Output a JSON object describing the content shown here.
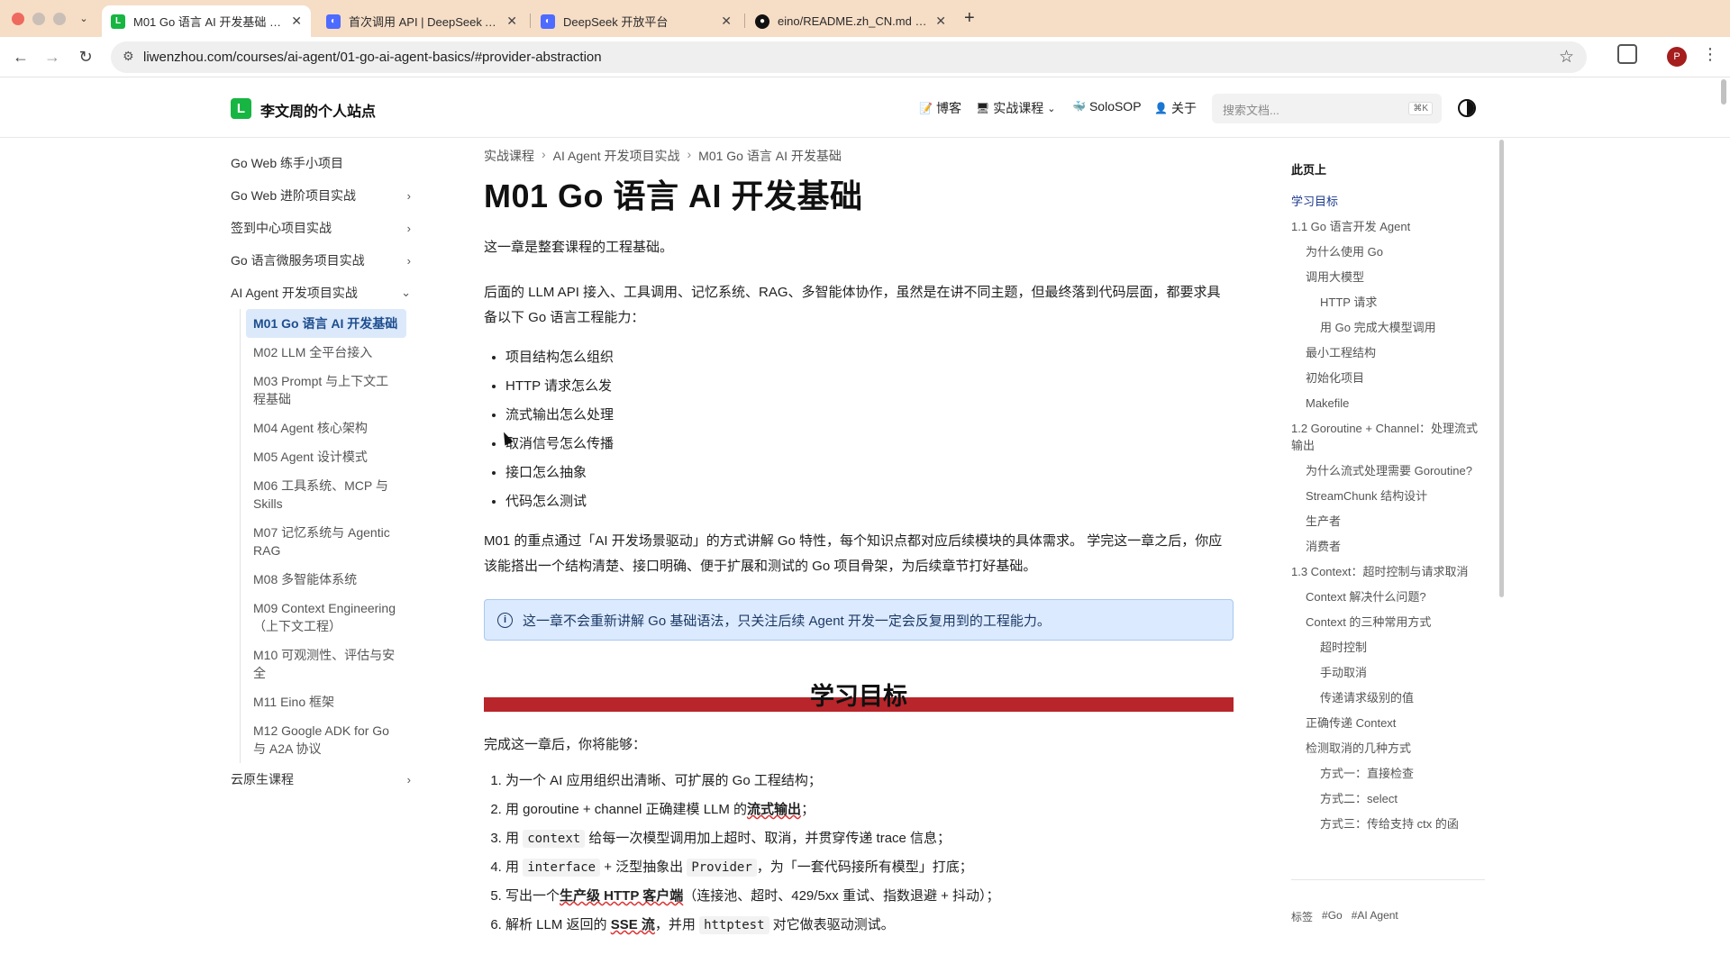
{
  "browser": {
    "tabs": [
      {
        "title": "M01 Go 语言 AI 开发基础 – 李文...",
        "icon": "L",
        "active": true
      },
      {
        "title": "首次调用 API | DeepSeek API D...",
        "icon": "deepseek-icon",
        "active": false
      },
      {
        "title": "DeepSeek 开放平台",
        "icon": "deepseek-icon",
        "active": false
      },
      {
        "title": "eino/README.zh_CN.md at m...",
        "icon": "github-icon",
        "active": false
      }
    ],
    "url": "liwenzhou.com/courses/ai-agent/01-go-ai-agent-basics/#provider-abstraction",
    "profile_initial": "P"
  },
  "site": {
    "logo_letter": "L",
    "title": "李文周的个人站点",
    "nav": {
      "blog": "博客",
      "courses": "实战课程",
      "solosop": "SoloSOP",
      "about": "关于"
    },
    "search_placeholder": "搜索文档...",
    "search_shortcut": "⌘K"
  },
  "sidebar": {
    "items": [
      {
        "label": "Go Web 练手小项目",
        "chevron": ""
      },
      {
        "label": "Go Web 进阶项目实战",
        "chevron": "›"
      },
      {
        "label": "签到中心项目实战",
        "chevron": "›"
      },
      {
        "label": "Go 语言微服务项目实战",
        "chevron": "›"
      },
      {
        "label": "AI Agent 开发项目实战",
        "chevron": "⌄"
      }
    ],
    "children": [
      "M01 Go 语言 AI 开发基础",
      "M02 LLM 全平台接入",
      "M03 Prompt 与上下文工程基础",
      "M04 Agent 核心架构",
      "M05 Agent 设计模式",
      "M06 工具系统、MCP 与 Skills",
      "M07 记忆系统与 Agentic RAG",
      "M08 多智能体系统",
      "M09 Context Engineering（上下文工程）",
      "M10 可观测性、评估与安全",
      "M11 Eino 框架",
      "M12 Google ADK for Go 与 A2A 协议"
    ],
    "last": {
      "label": "云原生课程",
      "chevron": "›"
    }
  },
  "main": {
    "breadcrumb": [
      "实战课程",
      "AI Agent 开发项目实战",
      "M01 Go 语言 AI 开发基础"
    ],
    "title": "M01 Go 语言 AI 开发基础",
    "intro": "这一章是整套课程的工程基础。",
    "para2": "后面的 LLM API 接入、工具调用、记忆系统、RAG、多智能体协作，虽然是在讲不同主题，但最终落到代码层面，都要求具备以下 Go 语言工程能力：",
    "bullets": [
      "项目结构怎么组织",
      "HTTP 请求怎么发",
      "流式输出怎么处理",
      "取消信号怎么传播",
      "接口怎么抽象",
      "代码怎么测试"
    ],
    "para3": "M01 的重点通过「AI 开发场景驱动」的方式讲解 Go 特性，每个知识点都对应后续模块的具体需求。 学完这一章之后，你应该能搭出一个结构清楚、接口明确、便于扩展和测试的 Go 项目骨架，为后续章节打好基础。",
    "callout": "这一章不会重新讲解 Go 基础语法，只关注后续 Agent 开发一定会反复用到的工程能力。",
    "section_title": "学习目标",
    "goals_intro": "完成这一章后，你将能够：",
    "goals": {
      "g1": "为一个 AI 应用组织出清晰、可扩展的 Go 工程结构；",
      "g2_a": "用 goroutine + channel 正确建模 LLM 的",
      "g2_b": "流式输出",
      "g2_c": "；",
      "g3_a": "用",
      "g3_code": "context",
      "g3_b": "给每一次模型调用加上超时、取消，并贯穿传递 trace 信息；",
      "g4_a": "用",
      "g4_code1": "interface",
      "g4_b": "+ 泛型抽象出",
      "g4_code2": "Provider",
      "g4_c": "，为「一套代码接所有模型」打底；",
      "g5_a": "写出一个",
      "g5_b": "生产级 HTTP 客户端",
      "g5_c": "（连接池、超时、429/5xx 重试、指数退避 + 抖动）；",
      "g6_a": "解析 LLM 返回的",
      "g6_b": "SSE 流",
      "g6_c": "，并用",
      "g6_code": "httptest",
      "g6_d": "对它做表驱动测试。"
    }
  },
  "toc": {
    "heading": "此页上",
    "items": [
      {
        "label": "学习目标",
        "level": 1,
        "active": true
      },
      {
        "label": "1.1 Go 语言开发 Agent",
        "level": 1
      },
      {
        "label": "为什么使用 Go",
        "level": 2
      },
      {
        "label": "调用大模型",
        "level": 2
      },
      {
        "label": "HTTP 请求",
        "level": 3
      },
      {
        "label": "用 Go 完成大模型调用",
        "level": 3
      },
      {
        "label": "最小工程结构",
        "level": 2
      },
      {
        "label": "初始化项目",
        "level": 2
      },
      {
        "label": "Makefile",
        "level": 2
      },
      {
        "label": "1.2 Goroutine + Channel：处理流式输出",
        "level": 1
      },
      {
        "label": "为什么流式处理需要 Goroutine?",
        "level": 2
      },
      {
        "label": "StreamChunk 结构设计",
        "level": 2
      },
      {
        "label": "生产者",
        "level": 2
      },
      {
        "label": "消费者",
        "level": 2
      },
      {
        "label": "1.3 Context：超时控制与请求取消",
        "level": 1
      },
      {
        "label": "Context 解决什么问题?",
        "level": 2
      },
      {
        "label": "Context 的三种常用方式",
        "level": 2
      },
      {
        "label": "超时控制",
        "level": 3
      },
      {
        "label": "手动取消",
        "level": 3
      },
      {
        "label": "传递请求级别的值",
        "level": 3
      },
      {
        "label": "正确传递 Context",
        "level": 2
      },
      {
        "label": "检测取消的几种方式",
        "level": 2
      },
      {
        "label": "方式一：直接检查",
        "level": 3
      },
      {
        "label": "方式二：select",
        "level": 3
      },
      {
        "label": "方式三：传给支持 ctx 的函",
        "level": 3
      }
    ],
    "tags_label": "标签",
    "tags": [
      "#Go",
      "#AI Agent"
    ]
  },
  "colors": {
    "accent": "#17b542",
    "section_bar": "#b8252a",
    "callout_bg": "#dbeafe",
    "tab_bar": "#f6ddc6"
  }
}
